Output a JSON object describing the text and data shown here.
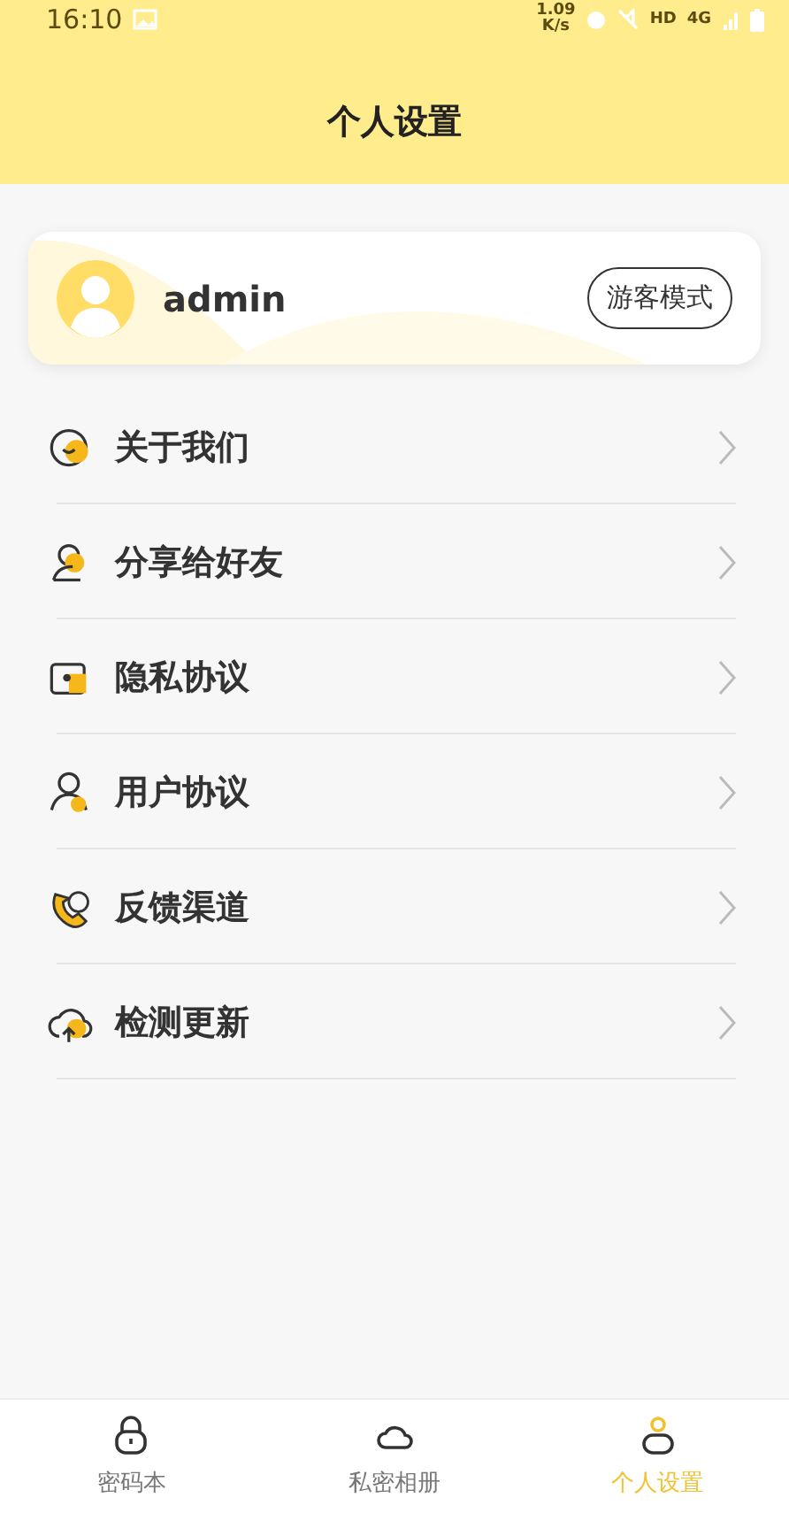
{
  "status_bar": {
    "time": "16:10",
    "speed_value": "1.09",
    "speed_unit": "K/s",
    "hd": "HD",
    "network": "4G"
  },
  "header": {
    "title": "个人设置"
  },
  "profile": {
    "username": "admin",
    "button": "游客模式"
  },
  "menu": [
    {
      "label": "关于我们"
    },
    {
      "label": "分享给好友"
    },
    {
      "label": "隐私协议"
    },
    {
      "label": "用户协议"
    },
    {
      "label": "反馈渠道"
    },
    {
      "label": "检测更新"
    }
  ],
  "tabs": [
    {
      "label": "密码本",
      "selected": false
    },
    {
      "label": "私密相册",
      "selected": false
    },
    {
      "label": "个人设置",
      "selected": true
    }
  ]
}
